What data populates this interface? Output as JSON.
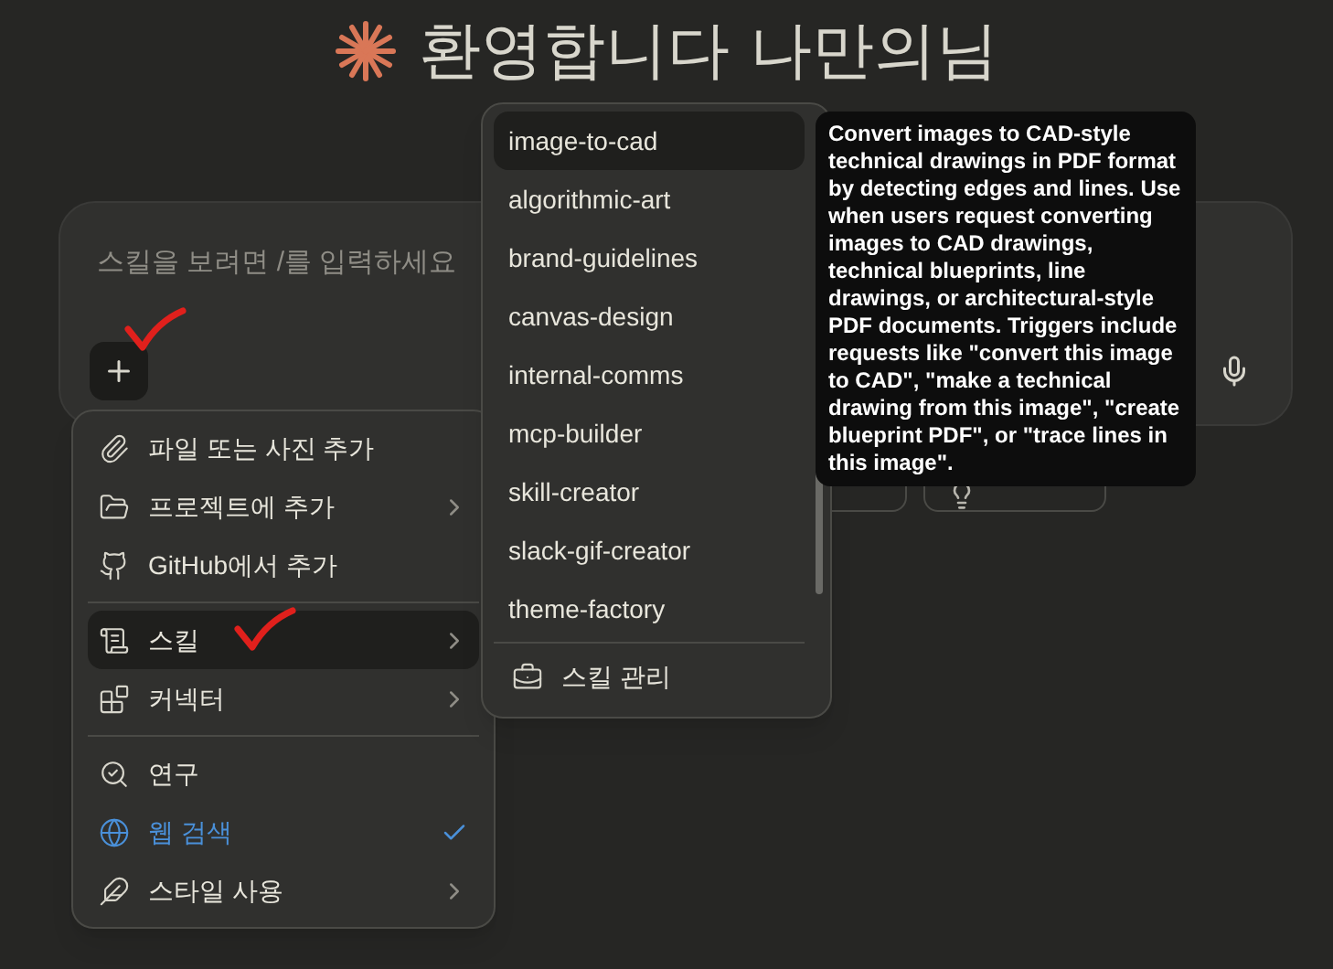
{
  "heading": {
    "text": "환영합니다 나만의님"
  },
  "composer": {
    "placeholder": "스킬을 보려면 /를 입력하세요"
  },
  "add_menu": {
    "groups": [
      [
        {
          "kind": "paperclip",
          "label": "파일 또는 사진 추가",
          "submenu": false,
          "selected": false,
          "checked": false
        },
        {
          "kind": "folder",
          "label": "프로젝트에 추가",
          "submenu": true,
          "selected": false,
          "checked": false
        },
        {
          "kind": "github",
          "label": "GitHub에서 추가",
          "submenu": false,
          "selected": false,
          "checked": false
        }
      ],
      [
        {
          "kind": "scroll",
          "label": "스킬",
          "submenu": true,
          "selected": true,
          "checked": false
        },
        {
          "kind": "blocks",
          "label": "커넥터",
          "submenu": true,
          "selected": false,
          "checked": false
        }
      ],
      [
        {
          "kind": "research",
          "label": "연구",
          "submenu": false,
          "selected": false,
          "checked": false
        },
        {
          "kind": "globe",
          "label": "웹 검색",
          "submenu": false,
          "selected": false,
          "checked": true
        },
        {
          "kind": "quill",
          "label": "스타일 사용",
          "submenu": true,
          "selected": false,
          "checked": false
        }
      ]
    ]
  },
  "skills_menu": {
    "items": [
      {
        "label": "image-to-cad",
        "selected": true
      },
      {
        "label": "algorithmic-art",
        "selected": false
      },
      {
        "label": "brand-guidelines",
        "selected": false
      },
      {
        "label": "canvas-design",
        "selected": false
      },
      {
        "label": "internal-comms",
        "selected": false
      },
      {
        "label": "mcp-builder",
        "selected": false
      },
      {
        "label": "skill-creator",
        "selected": false
      },
      {
        "label": "slack-gif-creator",
        "selected": false
      },
      {
        "label": "theme-factory",
        "selected": false
      }
    ],
    "footer": "스킬 관리"
  },
  "tooltip": {
    "text": "Convert images to CAD-style technical drawings in PDF format by detecting edges and lines. Use when users request converting images to CAD drawings, technical blueprints, line drawings, or architectural-style PDF documents. Triggers include requests like \"convert this image to CAD\", \"make a technical drawing from this image\", \"create blueprint PDF\", or \"trace lines in this image\"."
  }
}
